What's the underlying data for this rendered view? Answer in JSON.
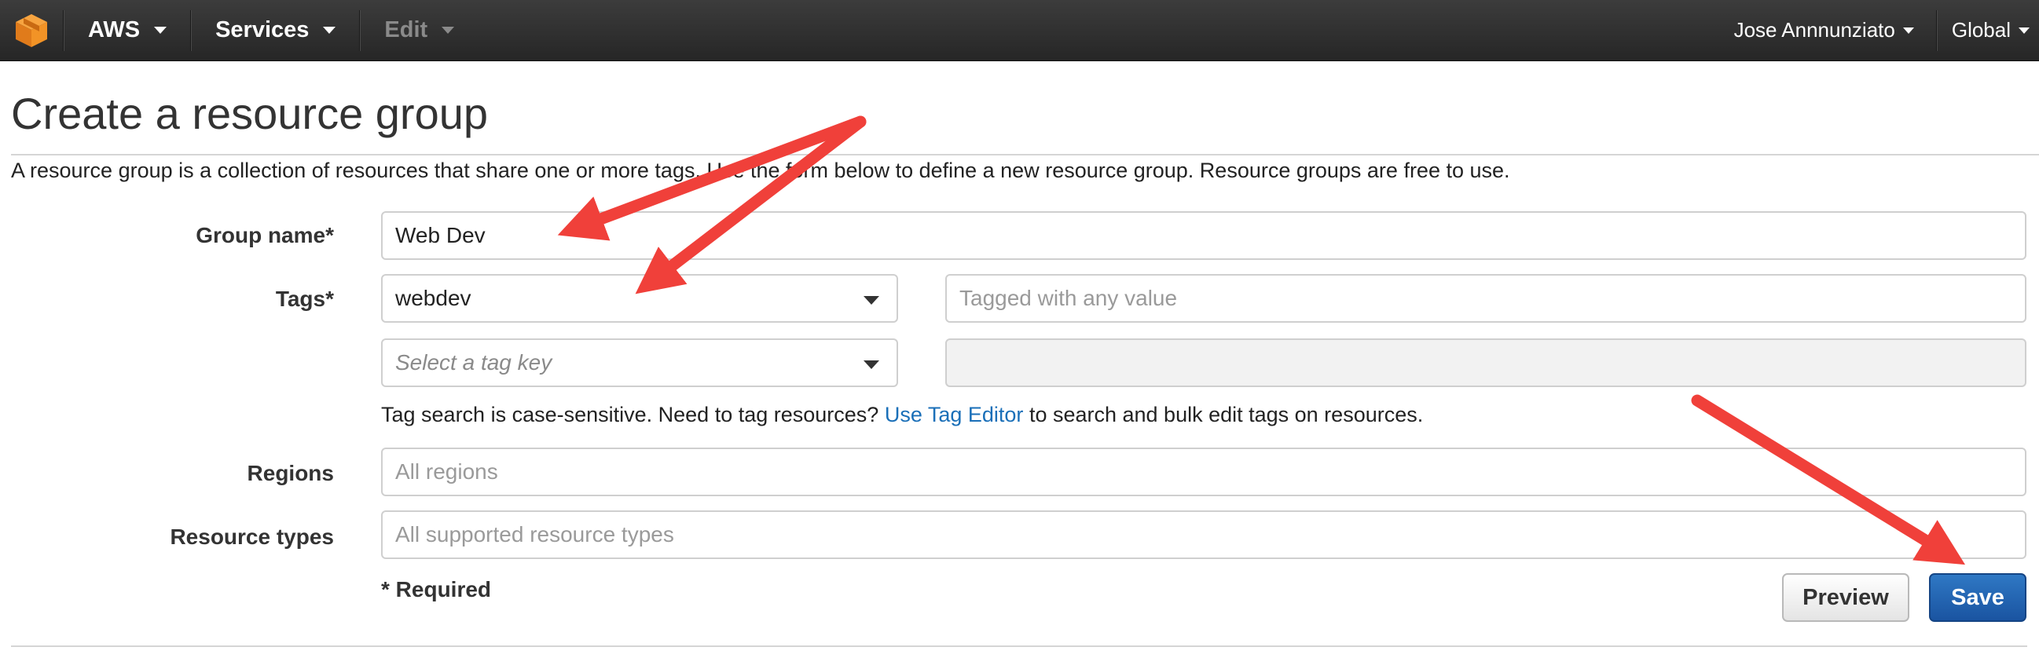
{
  "topbar": {
    "aws_label": "AWS",
    "services_label": "Services",
    "edit_label": "Edit",
    "user_label": "Jose Annnunziato",
    "region_label": "Global"
  },
  "page": {
    "title": "Create a resource group",
    "description": "A resource group is a collection of resources that share one or more tags. Use the form below to define a new resource group. Resource groups are free to use."
  },
  "form": {
    "group_name": {
      "label": "Group name*",
      "value": "Web Dev"
    },
    "tags": {
      "label": "Tags*",
      "rows": [
        {
          "key": "webdev",
          "key_placeholder": "",
          "value_placeholder": "Tagged with any value"
        },
        {
          "key": "",
          "key_placeholder": "Select a tag key",
          "value_placeholder": ""
        }
      ]
    },
    "hint": {
      "before": "Tag search is case-sensitive. Need to tag resources? ",
      "link": "Use Tag Editor",
      "after": " to search and bulk edit tags on resources."
    },
    "regions": {
      "label": "Regions",
      "placeholder": "All regions"
    },
    "resource_types": {
      "label": "Resource types",
      "placeholder": "All supported resource types"
    },
    "required_note": "* Required"
  },
  "buttons": {
    "preview_label": "Preview",
    "save_label": "Save"
  },
  "colors": {
    "topbar": "#2f2f2f",
    "link": "#1a6fb8",
    "save_button": "#1f5fae",
    "annotation_arrow": "#f0403a"
  },
  "icons": {
    "logo": "aws-cube-icon",
    "dropdown": "chevron-down-icon"
  }
}
